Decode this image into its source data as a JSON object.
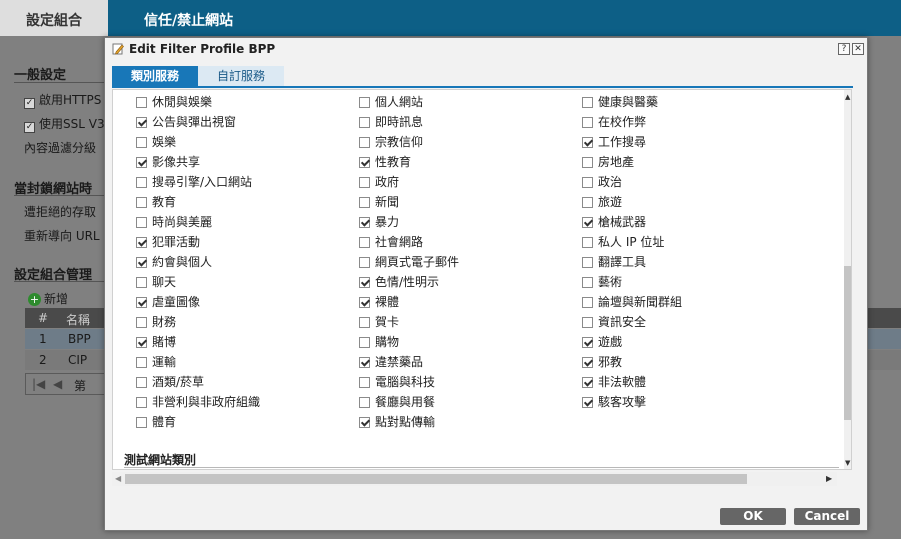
{
  "top_tabs": {
    "active": "設定組合",
    "inactive": "信任/禁止網站"
  },
  "background": {
    "general_settings": "一般設定",
    "enable_https": "啟用HTTPS",
    "use_ssl": "使用SSL V3",
    "content_filter_level": "內容過濾分級",
    "when_blocked": "當封鎖網站時",
    "deny_access": "遭拒絕的存取",
    "redirect_url": "重新導向 URL",
    "profile_mgmt": "設定組合管理",
    "add": "新增",
    "col_no": "#",
    "col_name": "名稱",
    "rows": [
      {
        "no": "1",
        "name": "BPP"
      },
      {
        "no": "2",
        "name": "CIP"
      }
    ],
    "page_label": "第"
  },
  "dialog": {
    "title": "Edit Filter Profile BPP",
    "help_glyph": "?",
    "close_glyph": "✕",
    "tabs": {
      "categories": "類別服務",
      "custom": "自訂服務"
    },
    "section_title": "測試網站類別",
    "ok": "OK",
    "cancel": "Cancel"
  },
  "categories": [
    [
      {
        "label": "休閒與娛樂",
        "checked": false
      },
      {
        "label": "公告與彈出視窗",
        "checked": true
      },
      {
        "label": "娛樂",
        "checked": false
      },
      {
        "label": "影像共享",
        "checked": true
      },
      {
        "label": "搜尋引擎/入口網站",
        "checked": false
      },
      {
        "label": "教育",
        "checked": false
      },
      {
        "label": "時尚與美麗",
        "checked": false
      },
      {
        "label": "犯罪活動",
        "checked": true
      },
      {
        "label": "約會與個人",
        "checked": true
      },
      {
        "label": "聊天",
        "checked": false
      },
      {
        "label": "虐童圖像",
        "checked": true
      },
      {
        "label": "財務",
        "checked": false
      },
      {
        "label": "賭博",
        "checked": true
      },
      {
        "label": "運輸",
        "checked": false
      },
      {
        "label": "酒類/菸草",
        "checked": false
      },
      {
        "label": "非營利與非政府組織",
        "checked": false
      },
      {
        "label": "體育",
        "checked": false
      }
    ],
    [
      {
        "label": "個人網站",
        "checked": false
      },
      {
        "label": "即時訊息",
        "checked": false
      },
      {
        "label": "宗教信仰",
        "checked": false
      },
      {
        "label": "性教育",
        "checked": true
      },
      {
        "label": "政府",
        "checked": false
      },
      {
        "label": "新聞",
        "checked": false
      },
      {
        "label": "暴力",
        "checked": true
      },
      {
        "label": "社會網路",
        "checked": false
      },
      {
        "label": "網頁式電子郵件",
        "checked": false
      },
      {
        "label": "色情/性明示",
        "checked": true
      },
      {
        "label": "裸體",
        "checked": true
      },
      {
        "label": "賀卡",
        "checked": false
      },
      {
        "label": "購物",
        "checked": false
      },
      {
        "label": "違禁藥品",
        "checked": true
      },
      {
        "label": "電腦與科技",
        "checked": false
      },
      {
        "label": "餐廳與用餐",
        "checked": false
      },
      {
        "label": "點對點傳輸",
        "checked": true
      }
    ],
    [
      {
        "label": "健康與醫藥",
        "checked": false
      },
      {
        "label": "在校作弊",
        "checked": false
      },
      {
        "label": "工作搜尋",
        "checked": true
      },
      {
        "label": "房地產",
        "checked": false
      },
      {
        "label": "政治",
        "checked": false
      },
      {
        "label": "旅遊",
        "checked": false
      },
      {
        "label": "槍械武器",
        "checked": true
      },
      {
        "label": "私人 IP 位址",
        "checked": false
      },
      {
        "label": "翻譯工具",
        "checked": false
      },
      {
        "label": "藝術",
        "checked": false
      },
      {
        "label": "論壇與新聞群組",
        "checked": false
      },
      {
        "label": "資訊安全",
        "checked": false
      },
      {
        "label": "遊戲",
        "checked": true
      },
      {
        "label": "邪教",
        "checked": true
      },
      {
        "label": "非法軟體",
        "checked": true
      },
      {
        "label": "駭客攻擊",
        "checked": true
      }
    ]
  ]
}
